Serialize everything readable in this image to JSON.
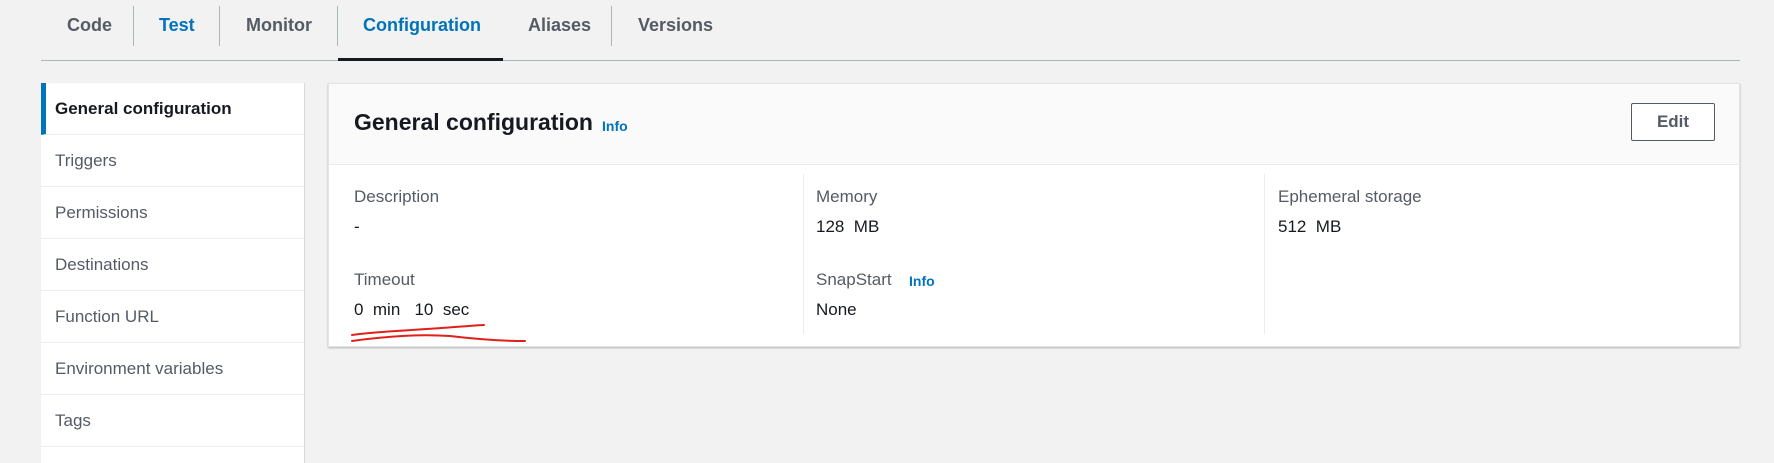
{
  "tabs": [
    {
      "label": "Code"
    },
    {
      "label": "Test"
    },
    {
      "label": "Monitor"
    },
    {
      "label": "Configuration"
    },
    {
      "label": "Aliases"
    },
    {
      "label": "Versions"
    }
  ],
  "sidebar": {
    "items": [
      {
        "label": "General configuration"
      },
      {
        "label": "Triggers"
      },
      {
        "label": "Permissions"
      },
      {
        "label": "Destinations"
      },
      {
        "label": "Function URL"
      },
      {
        "label": "Environment variables"
      },
      {
        "label": "Tags"
      }
    ]
  },
  "panel": {
    "title": "General configuration",
    "info_label": "Info",
    "edit_label": "Edit",
    "fields": {
      "description": {
        "label": "Description",
        "value": "-"
      },
      "timeout": {
        "label": "Timeout",
        "value": "0  min   10  sec"
      },
      "memory": {
        "label": "Memory",
        "value": "128  MB"
      },
      "snapstart": {
        "label": "SnapStart",
        "info_label": "Info",
        "value": "None"
      },
      "ephemeral": {
        "label": "Ephemeral storage",
        "value": "512  MB"
      }
    }
  },
  "colors": {
    "accent": "#0073bb",
    "annotation": "#e0201b"
  }
}
